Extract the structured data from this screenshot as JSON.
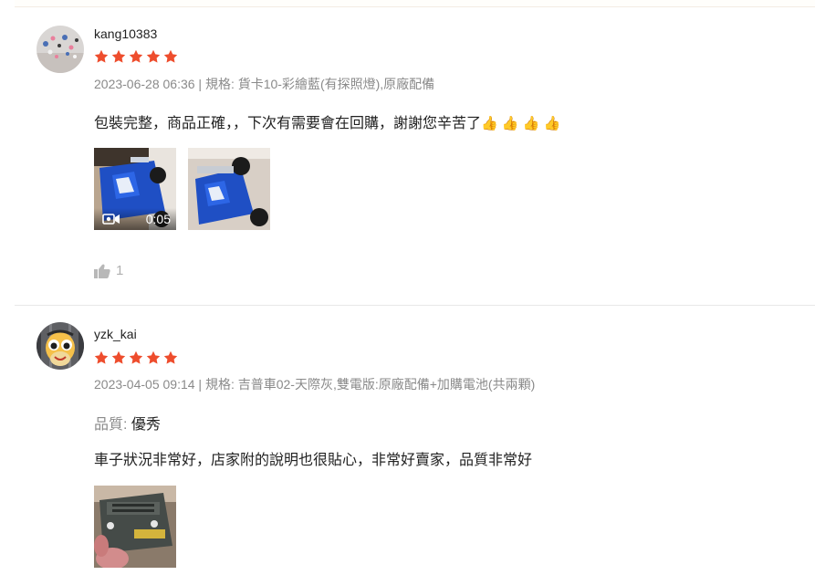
{
  "reviews": [
    {
      "username": "kang10383",
      "rating": 5,
      "meta": "2023-06-28 06:36 | 規格: 貨卡10-彩繪藍(有探照燈),原廠配備",
      "comment": "包裝完整，商品正確，，下次有需要會在回購，謝謝您辛苦了",
      "emoji": "👍 👍 👍 👍",
      "media": [
        {
          "type": "video",
          "duration": "0:05"
        },
        {
          "type": "image"
        }
      ],
      "likes": "1"
    },
    {
      "username": "yzk_kai",
      "rating": 5,
      "meta": "2023-04-05 09:14 | 規格: 吉普車02-天際灰,雙電版:原廠配備+加購電池(共兩顆)",
      "quality_label": "品質:",
      "quality_value": "優秀",
      "comment": "車子狀況非常好，店家附的說明也很貼心，非常好賣家，品質非常好",
      "media": [
        {
          "type": "image"
        }
      ]
    }
  ],
  "colors": {
    "star": "#ee4d2d",
    "meta_text": "#8a8a8a",
    "divider": "#e8e8e8"
  },
  "icons": {
    "star": "star-icon",
    "like": "thumbs-up-icon",
    "video": "video-camera-icon"
  }
}
